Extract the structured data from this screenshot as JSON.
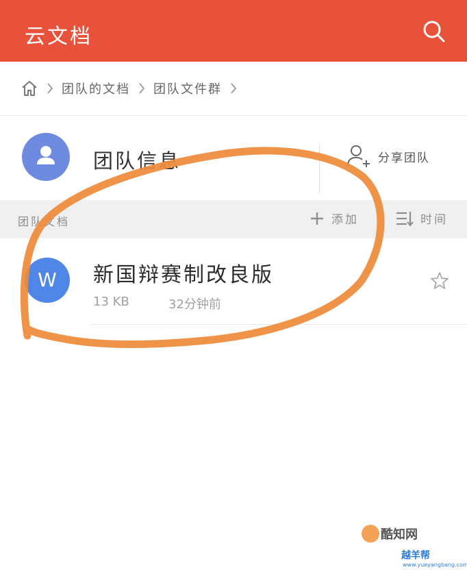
{
  "header": {
    "title": "云文档",
    "search_icon": "search-icon",
    "bg_color": "#e8513a"
  },
  "breadcrumb": {
    "home_icon": "home-icon",
    "items": [
      "团队的文档",
      "团队文件群"
    ]
  },
  "team": {
    "title": "团队信息",
    "avatar_icon": "person-icon",
    "share_label": "分享团队",
    "share_icon": "add-person-icon"
  },
  "section": {
    "label": "团队文档",
    "add_label": "添加",
    "sort_label": "时间"
  },
  "files": [
    {
      "name": "新国辩赛制改良版",
      "icon_letter": "W",
      "size": "13 KB",
      "modified": "32分钟前",
      "icon_color": "#4f86e8"
    }
  ],
  "watermark": {
    "line1": "酷知网",
    "line2": "越羊帮",
    "url": "www.yueyangbang.com"
  }
}
